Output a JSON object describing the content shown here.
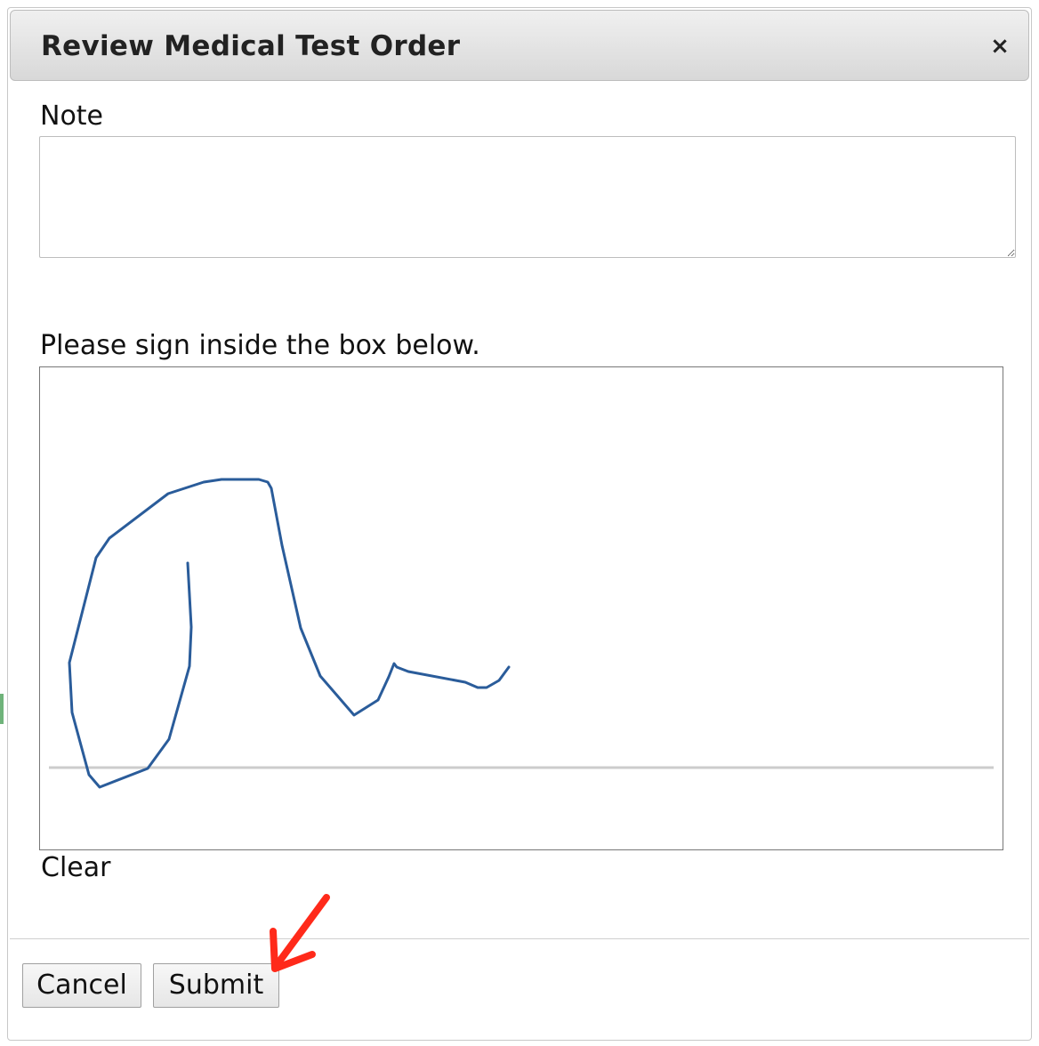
{
  "dialog": {
    "title": "Review Medical Test Order",
    "close_glyph": "×"
  },
  "note": {
    "label": "Note",
    "value": "",
    "placeholder": ""
  },
  "signature": {
    "prompt": "Please sign inside the box below.",
    "clear_label": "Clear",
    "stroke_color": "#2a5c9a",
    "baseline_color": "#cccccc"
  },
  "footer": {
    "cancel_label": "Cancel",
    "submit_label": "Submit"
  },
  "annotation": {
    "arrow_color": "#ff2a1a",
    "target": "submit-button"
  }
}
